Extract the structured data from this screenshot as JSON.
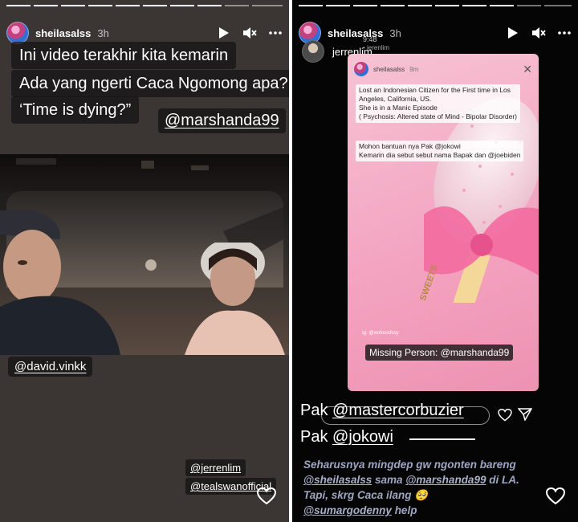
{
  "left_story": {
    "username": "sheilasalss",
    "time": "3h",
    "captions": [
      "Ini video terakhir kita kemarin",
      "Ada yang ngerti Caca Ngomong apa?",
      "‘Time is dying?”"
    ],
    "mention_main": "@marshanda99",
    "tag_person": "@david.vinkk",
    "tags_bottom": [
      "@jerrenlim",
      "@tealswanofficial"
    ]
  },
  "right_story": {
    "username": "sheilasalss",
    "time": "3h",
    "reposter_name": "jerrenlim",
    "reposter_clock": "9:48",
    "reposter_sub": "• jerenlim",
    "post": {
      "username": "sheilasalss",
      "time": "9m",
      "text_block_1": [
        "Lost an Indonesian Citizen for the First time in Los",
        "Angeles, California, US.",
        "She is in a Manic Episode",
        "( Psychosis: Altered state of Mind - Bipolar Disorder)"
      ],
      "text_block_2": [
        "Mohon bantuan nya Pak @jokowi",
        "Kemarin dia sebut sebut nama Bapak dan @joebiden"
      ],
      "stick_label": "SWEETS",
      "missing_label": "Missing Person: @marshanda99",
      "credit": "Ig: @verlosisfosy"
    },
    "reply_lines": [
      {
        "prefix": "Pak ",
        "mention": "@mastercorbuzier"
      },
      {
        "prefix": "Pak ",
        "mention": "@jokowi"
      }
    ],
    "bottom_text": {
      "line1": "Seharusnya mingdep gw ngonten bareng",
      "line2_m1": "@sheilasalss",
      "line2_mid": " sama ",
      "line2_m2": "@marshanda99",
      "line2_end": " di LA.",
      "line3": "Tapi, skrg Caca ilang 🥺",
      "line4_m": "@sumargodenny",
      "line4_end": " help"
    }
  },
  "colors": {
    "left_bg": "#3b3533",
    "right_bg": "#050505",
    "post_bg": "#f3a4c0",
    "bottom_text": "#9ea6c0"
  },
  "icons": [
    "play-icon",
    "mute-icon",
    "more-icon",
    "heart-icon",
    "send-icon",
    "close-icon"
  ]
}
